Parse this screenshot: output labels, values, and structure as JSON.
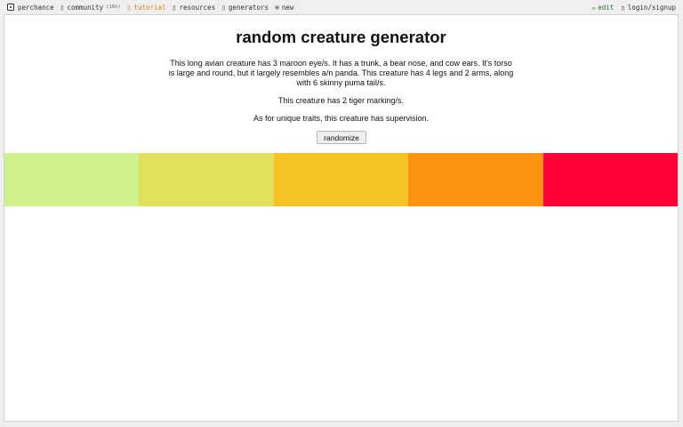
{
  "nav": {
    "brand": "perchance",
    "community": "community",
    "community_tag": "(16h)",
    "tutorial": "tutorial",
    "resources": "resources",
    "generators": "generators",
    "new": "new",
    "edit": "edit",
    "login": "login/signup",
    "icons": [
      "dice-logo-icon",
      "community-icon",
      "tutorial-icon",
      "resources-icon",
      "generators-icon",
      "plus-circle-icon",
      "pencil-icon",
      "user-icon"
    ]
  },
  "generator": {
    "title": "random creature generator",
    "description": "This long avian creature has 3 maroon eye/s. It has a trunk, a bear nose, and cow ears. It's torso is large and round, but it largely resembles a/n panda. This creature has 4 legs and 2 arms, along with 6 skinny puma tail/s.",
    "markings": "This creature has 2 tiger marking/s.",
    "traits": "As for unique traits, this creature has supervision.",
    "button": "randomize",
    "palette": [
      "#d0f28e",
      "#e0e05e",
      "#f5c326",
      "#fc9312",
      "#ff003b"
    ]
  },
  "colors": {
    "accent": "#e87b18",
    "edit": "#2a7a2a"
  }
}
